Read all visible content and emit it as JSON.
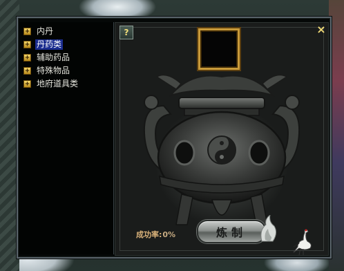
{
  "categories": [
    {
      "label": "内丹",
      "selected": false
    },
    {
      "label": "丹药类",
      "selected": true
    },
    {
      "label": "辅助药品",
      "selected": false
    },
    {
      "label": "特殊物品",
      "selected": false
    },
    {
      "label": "地府道具类",
      "selected": false
    }
  ],
  "help_symbol": "?",
  "close_symbol": "×",
  "success_rate_label": "成功率:",
  "success_rate_value": "0%",
  "craft_button_label": "炼制",
  "colors": {
    "selected_bg": "#1b2d8f",
    "slot_border": "#c89a3a",
    "accent_gold": "#f2dc78"
  }
}
